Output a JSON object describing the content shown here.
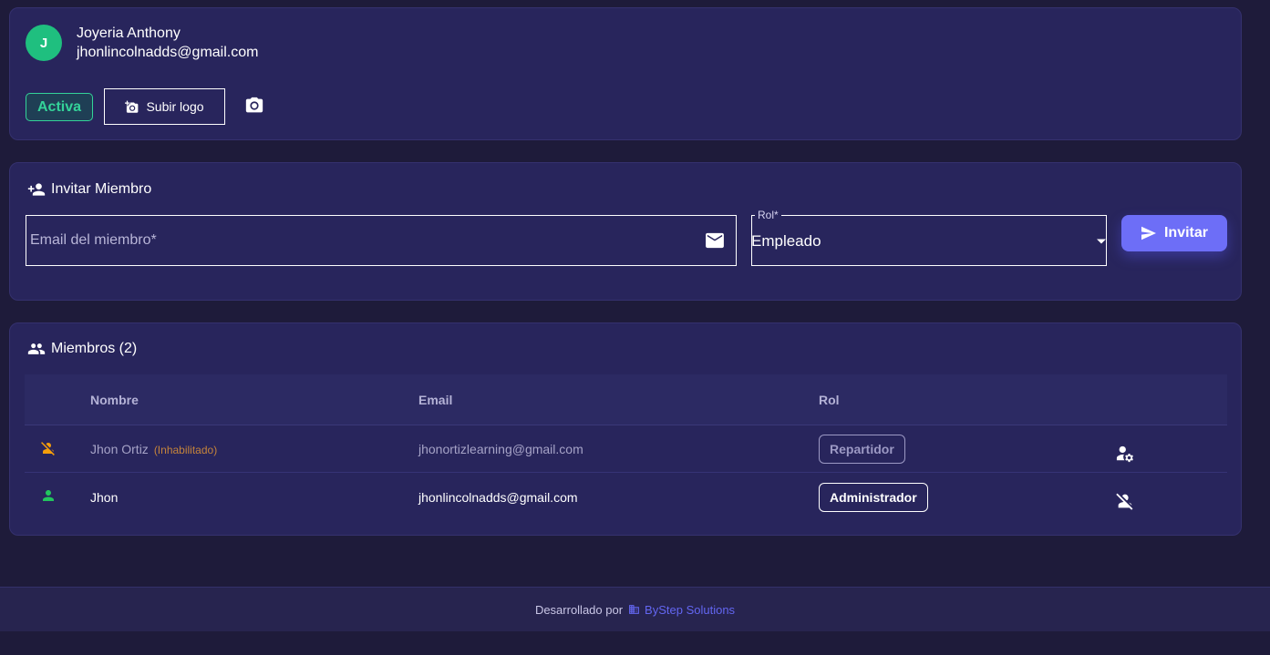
{
  "organization": {
    "avatar_initial": "J",
    "name": "Joyeria Anthony",
    "email": "jhonlincolnadds@gmail.com",
    "status": "Activa",
    "upload_logo_label": "Subir logo"
  },
  "invite": {
    "title": "Invitar Miembro",
    "email_placeholder": "Email del miembro*",
    "role_label": "Rol*",
    "role_value": "Empleado",
    "invite_label": "Invitar"
  },
  "members": {
    "title": "Miembros (2)",
    "columns": [
      "Nombre",
      "Email",
      "Rol"
    ],
    "rows": [
      {
        "name": "Jhon Ortiz",
        "tag": "(Inhabilitado)",
        "email": "jhonortizlearning@gmail.com",
        "role": "Repartidor",
        "enabled": false
      },
      {
        "name": "Jhon",
        "tag": "",
        "email": "jhonlincolnadds@gmail.com",
        "role": "Administrador",
        "enabled": true
      }
    ]
  },
  "footer": {
    "text": "Desarrollado por",
    "link": "ByStep Solutions"
  },
  "colors": {
    "background": "#1e1b3a",
    "card": "#28255c",
    "success": "#34d399",
    "primary": "#6d6ef7",
    "warning": "#f59e0b"
  }
}
